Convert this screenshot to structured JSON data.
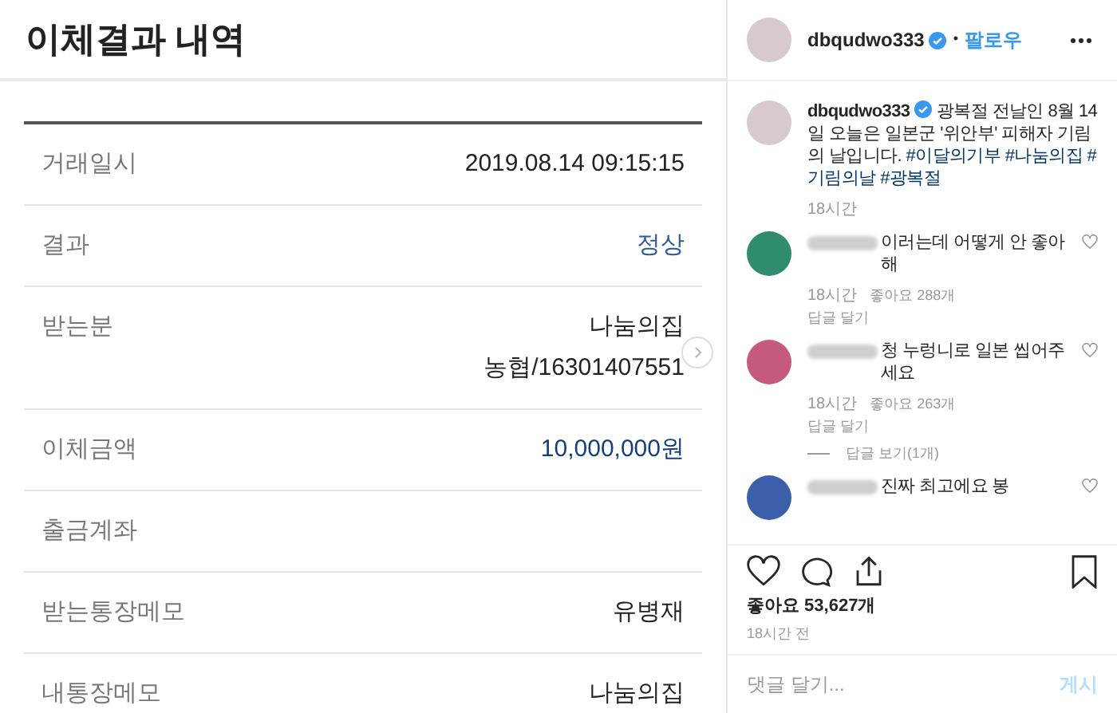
{
  "transfer": {
    "title": "이체결과 내역",
    "rows": [
      {
        "label": "거래일시",
        "values": [
          "2019.08.14 09:15:15"
        ],
        "kind": "plain"
      },
      {
        "label": "결과",
        "values": [
          "정상"
        ],
        "kind": "status"
      },
      {
        "label": "받는분",
        "values": [
          "나눔의집",
          "농협/16301407551"
        ],
        "kind": "plain"
      },
      {
        "label": "이체금액",
        "values": [
          "10,000,000원"
        ],
        "kind": "amount"
      },
      {
        "label": "출금계좌"
      },
      {
        "label": "받는통장메모",
        "values": [
          "유병재"
        ],
        "kind": "plain"
      },
      {
        "label": "내통장메모",
        "values": [
          "나눔의집"
        ],
        "kind": "plain"
      }
    ]
  },
  "post": {
    "username": "dbqudwo333",
    "verified": true,
    "separator": "•",
    "follow": "팔로우",
    "caption": {
      "username": "dbqudwo333",
      "text": "광복절 전날인 8월 14일 오늘은 일본군 '위안부' 피해자 기림의 날입니다.",
      "hashtags": [
        "#이달의기부",
        "#나눔의집",
        "#기림의날",
        "#광복절"
      ],
      "time": "18시간"
    },
    "comments": [
      {
        "text": "이러는데 어떻게 안 좋아해",
        "time": "18시간",
        "likes": "좋아요 288개",
        "reply": "답글 달기"
      },
      {
        "text": "청 누렁니로 일본 씹어주세요",
        "time": "18시간",
        "likes": "좋아요 263개",
        "reply": "답글 달기",
        "view_replies": "답글 보기(1개)"
      },
      {
        "text": "진짜 최고에요 봉"
      }
    ],
    "like_count": "좋아요 53,627개",
    "posted": "18시간 전",
    "comment_field": {
      "placeholder": "댓글 달기..."
    },
    "post_button": {
      "label": "게시",
      "disabled": true
    }
  }
}
